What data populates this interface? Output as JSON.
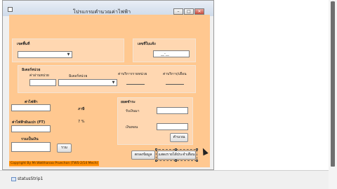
{
  "window": {
    "title": "โปรแกรมคำนวณค่าไฟฟ้า",
    "minimize_glyph": "–",
    "maximize_glyph": "□",
    "close_glyph": "✕"
  },
  "area_group": {
    "label": "เขตพื้นที่"
  },
  "meter_group": {
    "label": "เลขที่ใบแจ้ง",
    "value": "__-__"
  },
  "meter_reading": {
    "label": "มิเตอร์หน่วย",
    "current_label": "ค่าอ่านหน่วย",
    "previous_label": "มิเตอร์หน่วย",
    "rate_label": "ค่าบริการรายหน่วย",
    "service_label": "ค่าบริการ/เดือน"
  },
  "charges": {
    "energy_label": "ค่าไฟฟ้า",
    "energy_unit": "ภาษี",
    "ft_label": "ค่าไฟฟ้าผันแปร (FT)",
    "vat_value": "7 %",
    "total_label": "รวมเป็นเงิน",
    "sum_button": "รวม"
  },
  "payment": {
    "label": "ยอดชำระ",
    "received_label": "รับเงินมา",
    "change_label": "เงินทอน",
    "calc_button": "คำนวณ"
  },
  "actions": {
    "save_button": "ตกลงข้อมูล",
    "print_button": "แสดงรายได้ประจำเดือน"
  },
  "footer": {
    "copyright": "Copyright By Mr.Watthanaa Pruechon (TWS-2/14 Mech)"
  },
  "tray": {
    "label": "statusStrip1"
  },
  "scrollbar": {
    "up": "▲",
    "down": "▼"
  }
}
